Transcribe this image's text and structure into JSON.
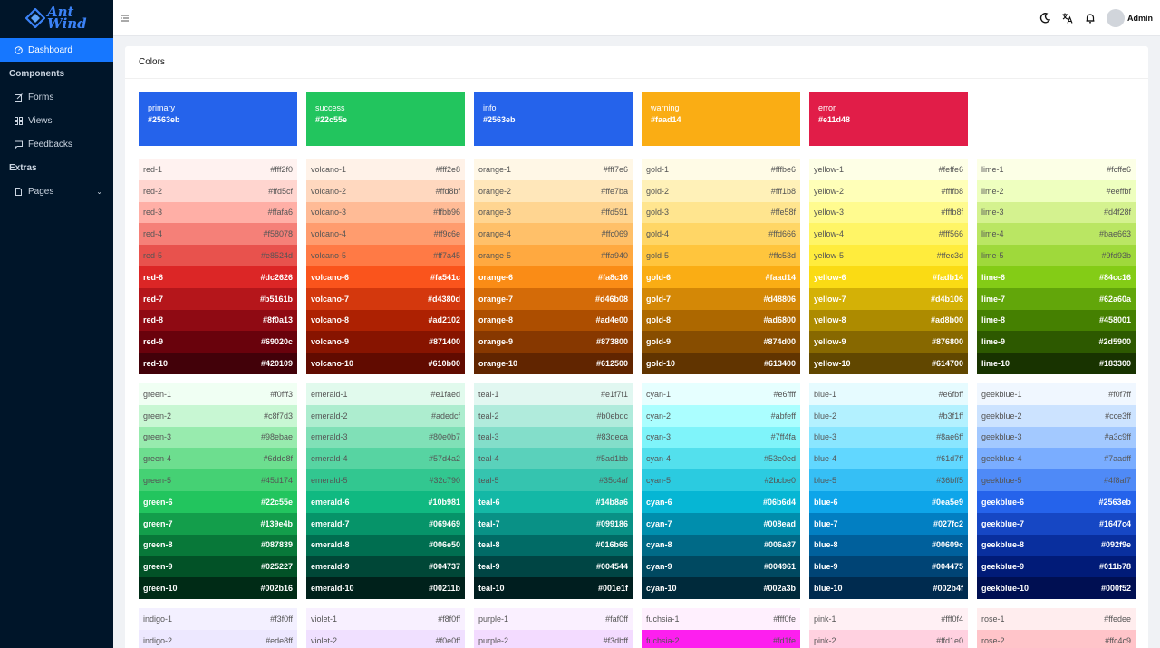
{
  "app": {
    "logo_line1": "Ant",
    "logo_line2": "Wind"
  },
  "sidebar": {
    "items": [
      {
        "label": "Dashboard",
        "icon": "dashboard-icon",
        "active": true
      },
      {
        "group": "Components"
      },
      {
        "label": "Forms",
        "icon": "forms-icon"
      },
      {
        "label": "Views",
        "icon": "views-icon"
      },
      {
        "label": "Feedbacks",
        "icon": "feedbacks-icon"
      },
      {
        "group": "Extras"
      },
      {
        "label": "Pages",
        "icon": "pages-icon",
        "chevron": true
      }
    ]
  },
  "header": {
    "user_name": "Admin",
    "icons": [
      "moon-icon",
      "translate-icon",
      "bell-icon"
    ]
  },
  "card": {
    "title": "Colors"
  },
  "brand_colors": [
    {
      "name": "primary",
      "hex": "#2563eb"
    },
    {
      "name": "success",
      "hex": "#22c55e"
    },
    {
      "name": "info",
      "hex": "#2563eb"
    },
    {
      "name": "warning",
      "hex": "#faad14"
    },
    {
      "name": "error",
      "hex": "#e11d48"
    }
  ],
  "palettes": [
    {
      "name": "red",
      "hexes": [
        "#fff2f0",
        "#ffd5cf",
        "#ffafa6",
        "#f58078",
        "#e8524d",
        "#dc2626",
        "#b5161b",
        "#8f0a13",
        "#69020c",
        "#420109"
      ]
    },
    {
      "name": "volcano",
      "hexes": [
        "#fff2e8",
        "#ffd8bf",
        "#ffbb96",
        "#ff9c6e",
        "#ff7a45",
        "#fa541c",
        "#d4380d",
        "#ad2102",
        "#871400",
        "#610b00"
      ]
    },
    {
      "name": "orange",
      "hexes": [
        "#fff7e6",
        "#ffe7ba",
        "#ffd591",
        "#ffc069",
        "#ffa940",
        "#fa8c16",
        "#d46b08",
        "#ad4e00",
        "#873800",
        "#612500"
      ]
    },
    {
      "name": "gold",
      "hexes": [
        "#fffbe6",
        "#fff1b8",
        "#ffe58f",
        "#ffd666",
        "#ffc53d",
        "#faad14",
        "#d48806",
        "#ad6800",
        "#874d00",
        "#613400"
      ]
    },
    {
      "name": "yellow",
      "hexes": [
        "#feffe6",
        "#ffffb8",
        "#fffb8f",
        "#fff566",
        "#ffec3d",
        "#fadb14",
        "#d4b106",
        "#ad8b00",
        "#876800",
        "#614700"
      ]
    },
    {
      "name": "lime",
      "hexes": [
        "#fcffe6",
        "#eeffbf",
        "#d4f28f",
        "#bae663",
        "#9fd93b",
        "#84cc16",
        "#62a60a",
        "#458001",
        "#2d5900",
        "#183300"
      ]
    },
    {
      "name": "green",
      "hexes": [
        "#f0fff3",
        "#c8f7d3",
        "#98ebae",
        "#6dde8f",
        "#45d174",
        "#22c55e",
        "#139e4b",
        "#087839",
        "#025227",
        "#002b16"
      ]
    },
    {
      "name": "emerald",
      "hexes": [
        "#e1faed",
        "#adedcf",
        "#80e0b7",
        "#57d4a2",
        "#32c790",
        "#10b981",
        "#069469",
        "#006e50",
        "#004737",
        "#00211b"
      ]
    },
    {
      "name": "teal",
      "hexes": [
        "#e1f7f1",
        "#b0ebdc",
        "#83deca",
        "#5ad1bb",
        "#35c4af",
        "#14b8a6",
        "#099186",
        "#016b66",
        "#004544",
        "#001e1f"
      ]
    },
    {
      "name": "cyan",
      "hexes": [
        "#e6ffff",
        "#abfeff",
        "#7ff4fa",
        "#53e0ed",
        "#2bcbe0",
        "#06b6d4",
        "#008ead",
        "#006a87",
        "#004961",
        "#002a3b"
      ]
    },
    {
      "name": "blue",
      "hexes": [
        "#e6fbff",
        "#b3f1ff",
        "#8ae6ff",
        "#61d7ff",
        "#36bff5",
        "#0ea5e9",
        "#027fc2",
        "#00609c",
        "#004475",
        "#002b4f"
      ]
    },
    {
      "name": "geekblue",
      "hexes": [
        "#f0f7ff",
        "#cce3ff",
        "#a3c9ff",
        "#7aadff",
        "#4f8af7",
        "#2563eb",
        "#1647c4",
        "#092f9e",
        "#011b78",
        "#000f52"
      ]
    },
    {
      "name": "indigo",
      "hexes": [
        "#f3f0ff",
        "#ede8ff"
      ]
    },
    {
      "name": "violet",
      "hexes": [
        "#f8f0ff",
        "#f0e0ff"
      ]
    },
    {
      "name": "purple",
      "hexes": [
        "#faf0ff",
        "#f3dbff"
      ]
    },
    {
      "name": "fuchsia",
      "hexes": [
        "#fff0fe",
        "#fd1fe"
      ]
    },
    {
      "name": "pink",
      "hexes": [
        "#fff0f4",
        "#ffd1e0"
      ]
    },
    {
      "name": "rose",
      "hexes": [
        "#ffedee",
        "#ffc4c9"
      ]
    }
  ]
}
